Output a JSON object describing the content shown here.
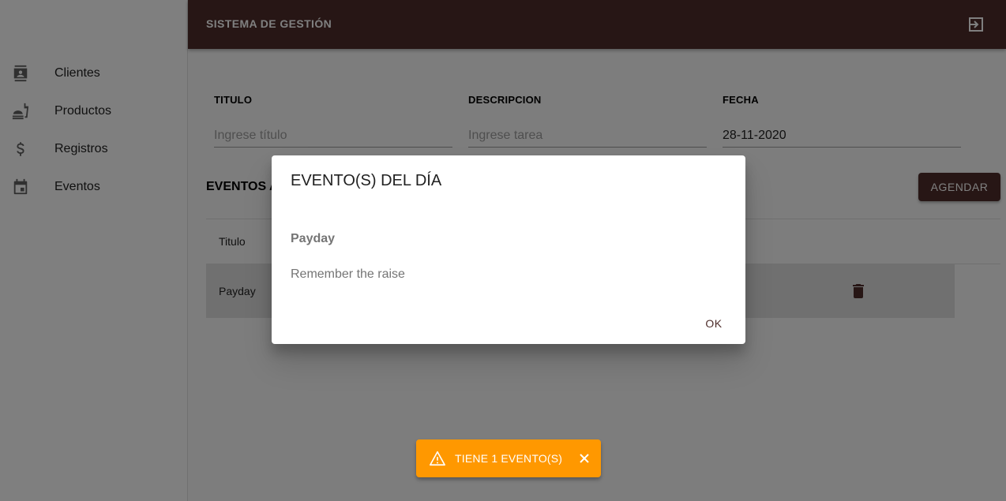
{
  "app": {
    "title": "SISTEMA DE GESTIÓN",
    "brand_color": "#4e2d2b",
    "warning_color": "#ff9800"
  },
  "sidebar": {
    "items": [
      {
        "label": "Clientes",
        "icon": "contacts-icon"
      },
      {
        "label": "Productos",
        "icon": "fastfood-icon"
      },
      {
        "label": "Registros",
        "icon": "dollar-icon"
      },
      {
        "label": "Eventos",
        "icon": "calendar-icon"
      }
    ]
  },
  "form": {
    "titulo_label": "TITULO",
    "titulo_placeholder": "Ingrese título",
    "descripcion_label": "DESCRIPCION",
    "descripcion_placeholder": "Ingrese tarea",
    "fecha_label": "FECHA",
    "fecha_value": "28-11-2020"
  },
  "events_section": {
    "title": "EVENTOS A",
    "agendar_label": "AGENDAR",
    "columns": [
      "Titulo"
    ],
    "rows": [
      {
        "titulo": "Payday"
      }
    ]
  },
  "dialog": {
    "title": "EVENTO(S) DEL DÍA",
    "event_title": "Payday",
    "event_description": "Remember the raise",
    "ok_label": "OK"
  },
  "snackbar": {
    "text": "TIENE 1 EVENTO(S)"
  }
}
